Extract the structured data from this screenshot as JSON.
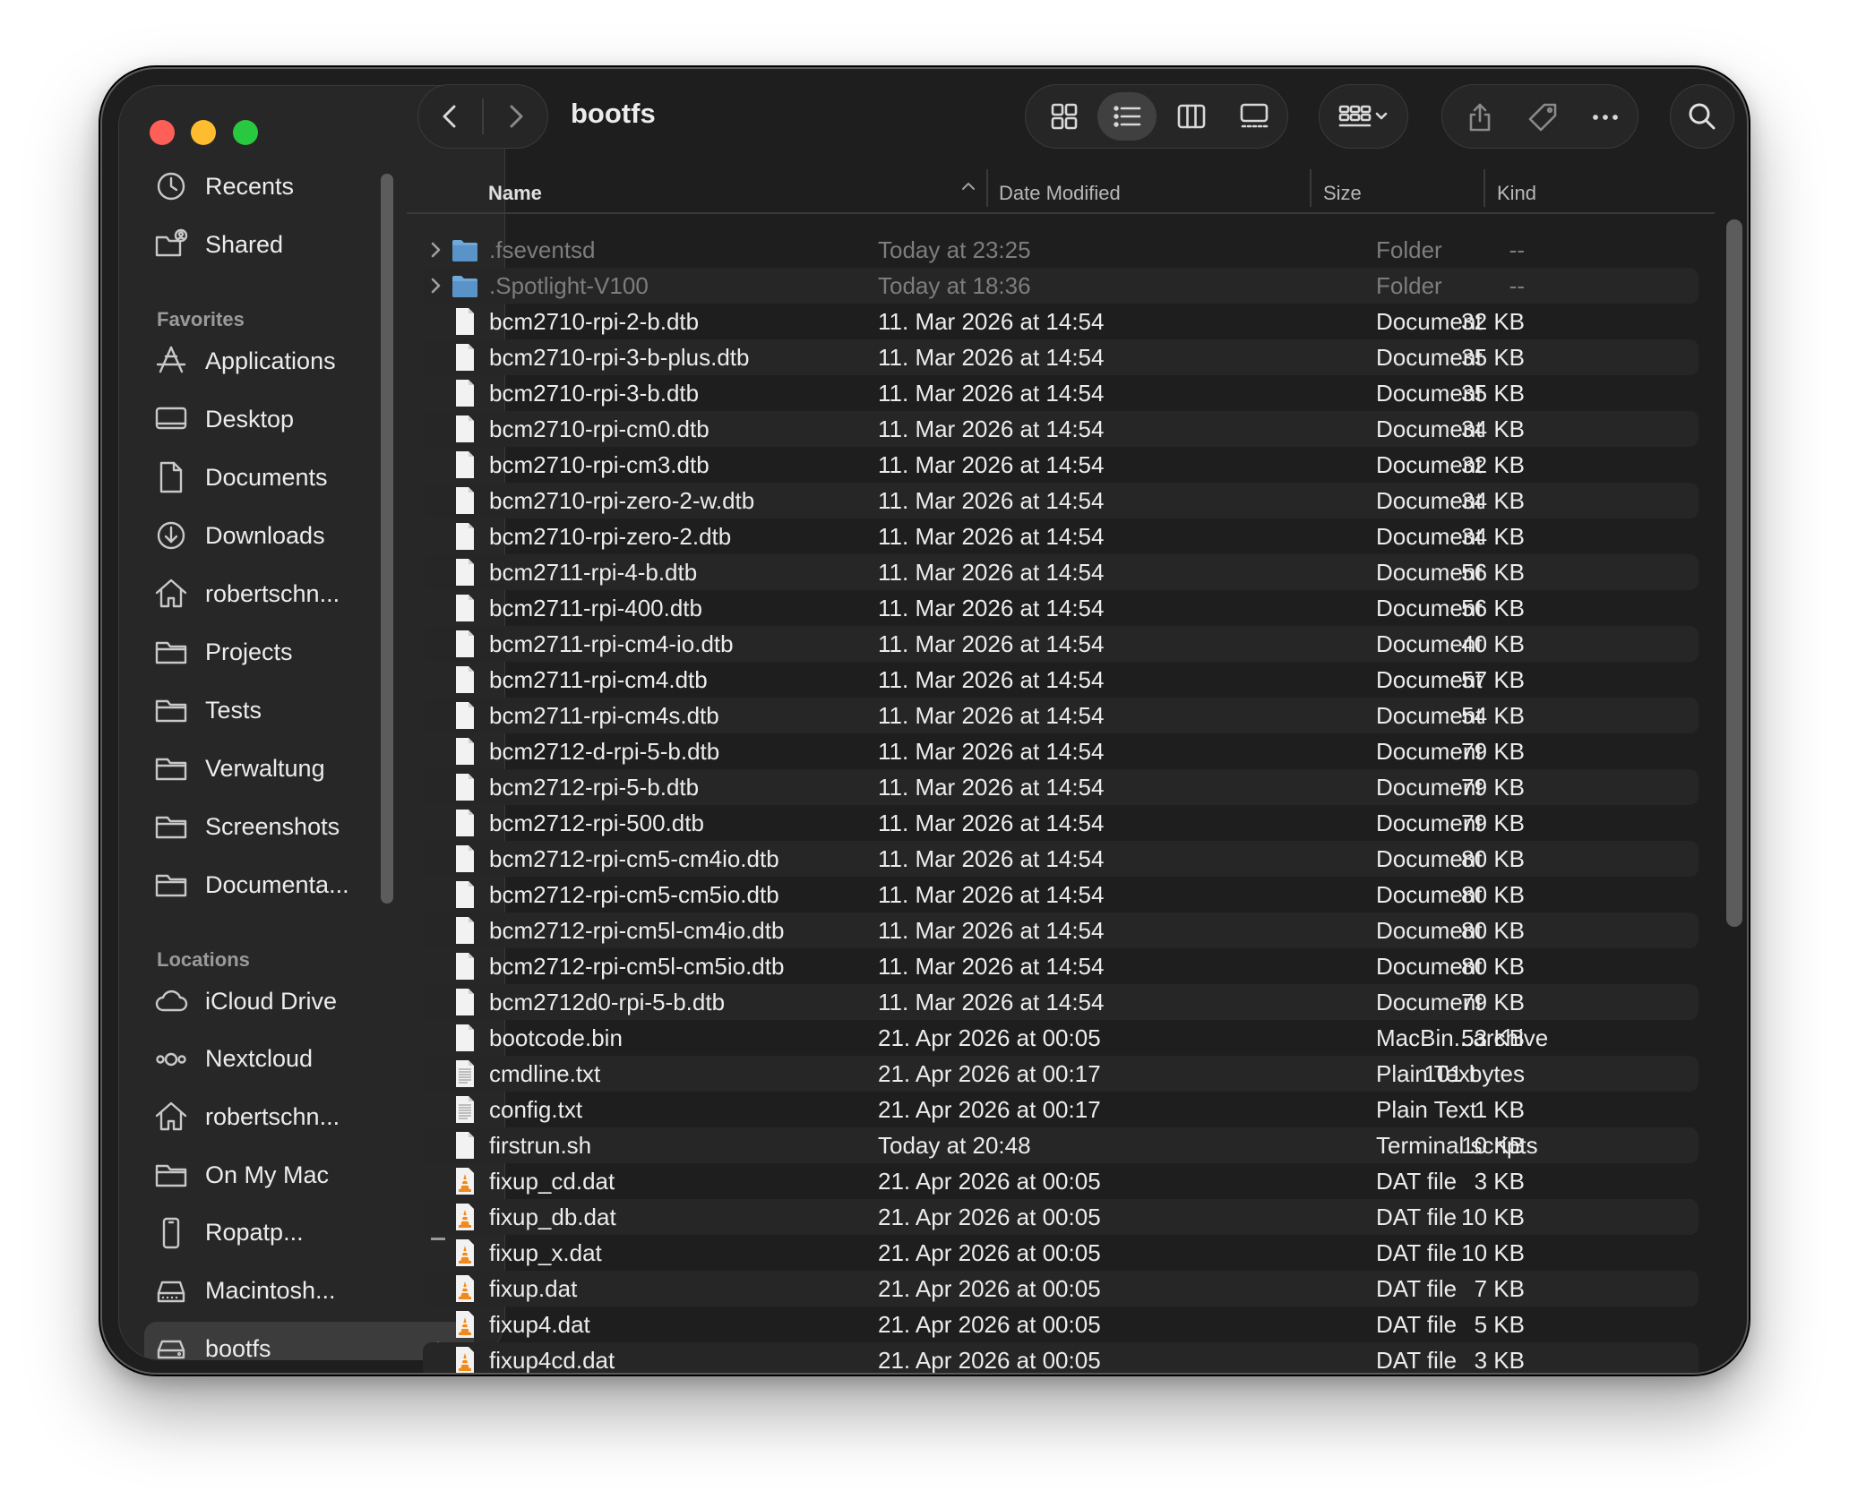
{
  "window": {
    "title": "bootfs"
  },
  "sidebar": {
    "top_items": [
      {
        "label": "Recents",
        "icon": "clock-icon"
      },
      {
        "label": "Shared",
        "icon": "shared-folder-icon"
      }
    ],
    "favorites_title": "Favorites",
    "favorites": [
      {
        "label": "Applications",
        "icon": "applications-icon"
      },
      {
        "label": "Desktop",
        "icon": "desktop-icon"
      },
      {
        "label": "Documents",
        "icon": "document-icon"
      },
      {
        "label": "Downloads",
        "icon": "download-icon"
      },
      {
        "label": "robertschn...",
        "icon": "home-icon"
      },
      {
        "label": "Projects",
        "icon": "folder-icon"
      },
      {
        "label": "Tests",
        "icon": "folder-icon"
      },
      {
        "label": "Verwaltung",
        "icon": "folder-icon"
      },
      {
        "label": "Screenshots",
        "icon": "folder-icon"
      },
      {
        "label": "Documenta...",
        "icon": "folder-icon"
      }
    ],
    "locations_title": "Locations",
    "locations": [
      {
        "label": "iCloud Drive",
        "icon": "cloud-icon"
      },
      {
        "label": "Nextcloud",
        "icon": "nextcloud-icon"
      },
      {
        "label": "robertschn...",
        "icon": "home-icon"
      },
      {
        "label": "On My Mac",
        "icon": "folder-icon"
      },
      {
        "label": "Ropatp...",
        "icon": "phone-icon",
        "eject": true
      },
      {
        "label": "Macintosh...",
        "icon": "drive-icon"
      },
      {
        "label": "bootfs",
        "icon": "external-drive-icon",
        "eject": true,
        "selected": true
      }
    ]
  },
  "columns": {
    "name": "Name",
    "date": "Date Modified",
    "size": "Size",
    "kind": "Kind"
  },
  "files": [
    {
      "name": ".fseventsd",
      "date": "Today at 23:25",
      "size": "--",
      "kind": "Folder",
      "type": "folder",
      "hidden": true
    },
    {
      "name": ".Spotlight-V100",
      "date": "Today at 18:36",
      "size": "--",
      "kind": "Folder",
      "type": "folder",
      "hidden": true
    },
    {
      "name": "bcm2710-rpi-2-b.dtb",
      "date": "11. Mar 2026 at 14:54",
      "size": "32 KB",
      "kind": "Document",
      "type": "doc"
    },
    {
      "name": "bcm2710-rpi-3-b-plus.dtb",
      "date": "11. Mar 2026 at 14:54",
      "size": "35 KB",
      "kind": "Document",
      "type": "doc"
    },
    {
      "name": "bcm2710-rpi-3-b.dtb",
      "date": "11. Mar 2026 at 14:54",
      "size": "35 KB",
      "kind": "Document",
      "type": "doc"
    },
    {
      "name": "bcm2710-rpi-cm0.dtb",
      "date": "11. Mar 2026 at 14:54",
      "size": "34 KB",
      "kind": "Document",
      "type": "doc"
    },
    {
      "name": "bcm2710-rpi-cm3.dtb",
      "date": "11. Mar 2026 at 14:54",
      "size": "32 KB",
      "kind": "Document",
      "type": "doc"
    },
    {
      "name": "bcm2710-rpi-zero-2-w.dtb",
      "date": "11. Mar 2026 at 14:54",
      "size": "34 KB",
      "kind": "Document",
      "type": "doc"
    },
    {
      "name": "bcm2710-rpi-zero-2.dtb",
      "date": "11. Mar 2026 at 14:54",
      "size": "34 KB",
      "kind": "Document",
      "type": "doc"
    },
    {
      "name": "bcm2711-rpi-4-b.dtb",
      "date": "11. Mar 2026 at 14:54",
      "size": "56 KB",
      "kind": "Document",
      "type": "doc"
    },
    {
      "name": "bcm2711-rpi-400.dtb",
      "date": "11. Mar 2026 at 14:54",
      "size": "56 KB",
      "kind": "Document",
      "type": "doc"
    },
    {
      "name": "bcm2711-rpi-cm4-io.dtb",
      "date": "11. Mar 2026 at 14:54",
      "size": "40 KB",
      "kind": "Document",
      "type": "doc"
    },
    {
      "name": "bcm2711-rpi-cm4.dtb",
      "date": "11. Mar 2026 at 14:54",
      "size": "57 KB",
      "kind": "Document",
      "type": "doc"
    },
    {
      "name": "bcm2711-rpi-cm4s.dtb",
      "date": "11. Mar 2026 at 14:54",
      "size": "54 KB",
      "kind": "Document",
      "type": "doc"
    },
    {
      "name": "bcm2712-d-rpi-5-b.dtb",
      "date": "11. Mar 2026 at 14:54",
      "size": "79 KB",
      "kind": "Document",
      "type": "doc"
    },
    {
      "name": "bcm2712-rpi-5-b.dtb",
      "date": "11. Mar 2026 at 14:54",
      "size": "79 KB",
      "kind": "Document",
      "type": "doc"
    },
    {
      "name": "bcm2712-rpi-500.dtb",
      "date": "11. Mar 2026 at 14:54",
      "size": "79 KB",
      "kind": "Document",
      "type": "doc"
    },
    {
      "name": "bcm2712-rpi-cm5-cm4io.dtb",
      "date": "11. Mar 2026 at 14:54",
      "size": "80 KB",
      "kind": "Document",
      "type": "doc"
    },
    {
      "name": "bcm2712-rpi-cm5-cm5io.dtb",
      "date": "11. Mar 2026 at 14:54",
      "size": "80 KB",
      "kind": "Document",
      "type": "doc"
    },
    {
      "name": "bcm2712-rpi-cm5l-cm4io.dtb",
      "date": "11. Mar 2026 at 14:54",
      "size": "80 KB",
      "kind": "Document",
      "type": "doc"
    },
    {
      "name": "bcm2712-rpi-cm5l-cm5io.dtb",
      "date": "11. Mar 2026 at 14:54",
      "size": "80 KB",
      "kind": "Document",
      "type": "doc"
    },
    {
      "name": "bcm2712d0-rpi-5-b.dtb",
      "date": "11. Mar 2026 at 14:54",
      "size": "79 KB",
      "kind": "Document",
      "type": "doc"
    },
    {
      "name": "bootcode.bin",
      "date": "21. Apr 2026 at 00:05",
      "size": "53 KB",
      "kind": "MacBin...archive",
      "type": "doc"
    },
    {
      "name": "cmdline.txt",
      "date": "21. Apr 2026 at 00:17",
      "size": "101 bytes",
      "kind": "Plain Text",
      "type": "text"
    },
    {
      "name": "config.txt",
      "date": "21. Apr 2026 at 00:17",
      "size": "1 KB",
      "kind": "Plain Text",
      "type": "text"
    },
    {
      "name": "firstrun.sh",
      "date": "Today at 20:48",
      "size": "10 KB",
      "kind": "Terminal scripts",
      "type": "doc"
    },
    {
      "name": "fixup_cd.dat",
      "date": "21. Apr 2026 at 00:05",
      "size": "3 KB",
      "kind": "DAT file",
      "type": "dat"
    },
    {
      "name": "fixup_db.dat",
      "date": "21. Apr 2026 at 00:05",
      "size": "10 KB",
      "kind": "DAT file",
      "type": "dat"
    },
    {
      "name": "fixup_x.dat",
      "date": "21. Apr 2026 at 00:05",
      "size": "10 KB",
      "kind": "DAT file",
      "type": "dat"
    },
    {
      "name": "fixup.dat",
      "date": "21. Apr 2026 at 00:05",
      "size": "7 KB",
      "kind": "DAT file",
      "type": "dat"
    },
    {
      "name": "fixup4.dat",
      "date": "21. Apr 2026 at 00:05",
      "size": "5 KB",
      "kind": "DAT file",
      "type": "dat"
    },
    {
      "name": "fixup4cd.dat",
      "date": "21. Apr 2026 at 00:05",
      "size": "3 KB",
      "kind": "DAT file",
      "type": "dat"
    },
    {
      "name": "",
      "date": "",
      "size": "",
      "kind": "",
      "type": "doc"
    }
  ],
  "colors": {
    "close": "#ff5f57",
    "minimize": "#febc2e",
    "maximize": "#28c840",
    "folder": "#6fa9d9",
    "vlc_orange": "#f08a1c"
  }
}
